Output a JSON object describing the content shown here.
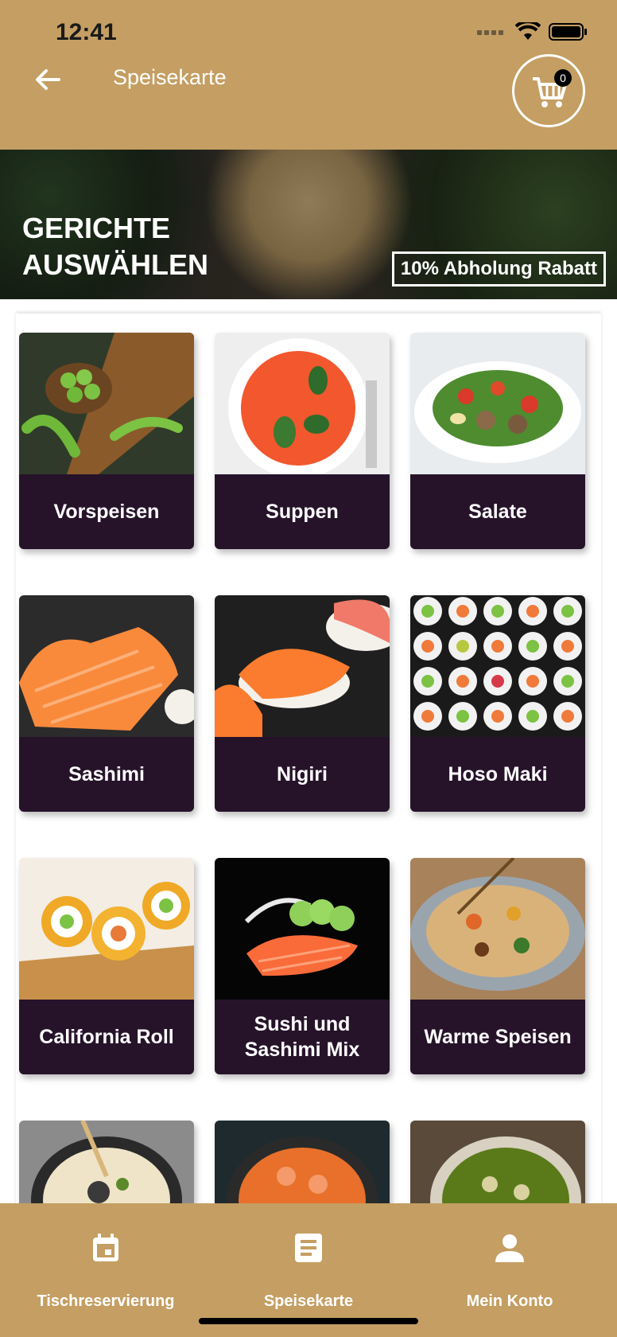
{
  "status": {
    "time": "12:41"
  },
  "header": {
    "title": "Speisekarte",
    "cart_count": "0"
  },
  "banner": {
    "title_line1": "GERICHTE",
    "title_line2": "AUSWÄHLEN",
    "discount": "10% Abholung Rabatt"
  },
  "categories": [
    {
      "label": "Vorspeisen"
    },
    {
      "label": "Suppen"
    },
    {
      "label": "Salate"
    },
    {
      "label": "Sashimi"
    },
    {
      "label": "Nigiri"
    },
    {
      "label": "Hoso Maki"
    },
    {
      "label": "California Roll"
    },
    {
      "label": "Sushi und Sashimi Mix"
    },
    {
      "label": "Warme Speisen"
    },
    {
      "label": ""
    },
    {
      "label": ""
    },
    {
      "label": ""
    }
  ],
  "bottom_nav": {
    "items": [
      {
        "label": "Tischreservierung",
        "icon": "calendar-icon"
      },
      {
        "label": "Speisekarte",
        "icon": "menu-document-icon"
      },
      {
        "label": "Mein Konto",
        "icon": "person-icon"
      }
    ]
  },
  "colors": {
    "brand": "#c49e62",
    "card_label": "#26132a"
  }
}
